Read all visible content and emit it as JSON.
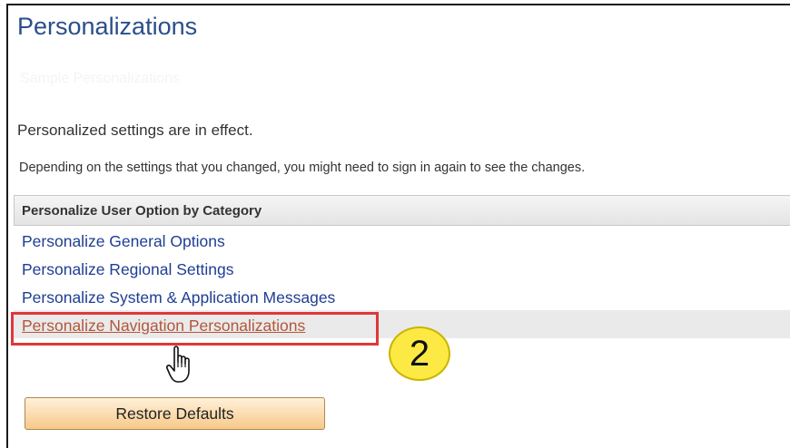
{
  "page": {
    "title": "Personalizations",
    "subtitle_faded": "Sample Personalizations",
    "status": "Personalized settings are in effect.",
    "note": "Depending on the settings that you changed, you might need to sign in again to see the changes."
  },
  "category_table": {
    "header": "Personalize User Option by Category",
    "items": [
      {
        "label": "Personalize General Options"
      },
      {
        "label": "Personalize Regional Settings"
      },
      {
        "label": "Personalize System & Application Messages"
      },
      {
        "label": "Personalize Navigation Personalizations"
      }
    ]
  },
  "annotation": {
    "step_number": "2",
    "highlight_color": "#e0373a",
    "badge_color": "#fce944"
  },
  "actions": {
    "restore_label": "Restore Defaults"
  },
  "icons": {
    "cursor": "hand-pointer-icon"
  },
  "colors": {
    "title": "#2a4e8a",
    "link": "#1f3e93",
    "visited_link": "#b4563a",
    "button_bg": "#f7c98a"
  }
}
